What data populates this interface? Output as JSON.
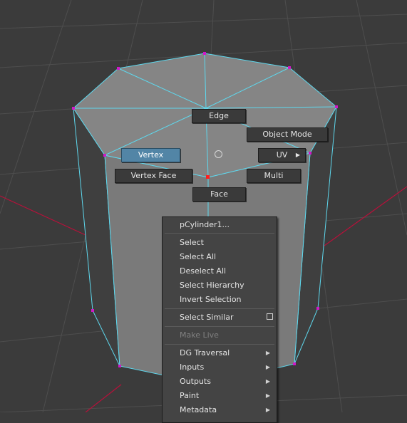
{
  "marking_menu": {
    "edge": "Edge",
    "object_mode": "Object Mode",
    "vertex": "Vertex",
    "uv": "UV",
    "vertex_face": "Vertex Face",
    "multi": "Multi",
    "face": "Face"
  },
  "context_menu": {
    "title": "pCylinder1...",
    "items": [
      "Select",
      "Select All",
      "Deselect All",
      "Select Hierarchy",
      "Invert Selection",
      "Select Similar",
      "Make Live",
      "DG Traversal",
      "Inputs",
      "Outputs",
      "Paint",
      "Metadata"
    ]
  },
  "colors": {
    "viewport_bg": "#3b3b3b",
    "grid_line": "#555555",
    "grid_axis": "#b8103a",
    "wire": "#5ed8ee",
    "vertex": "#d018c8",
    "highlight": "#5285a6"
  }
}
